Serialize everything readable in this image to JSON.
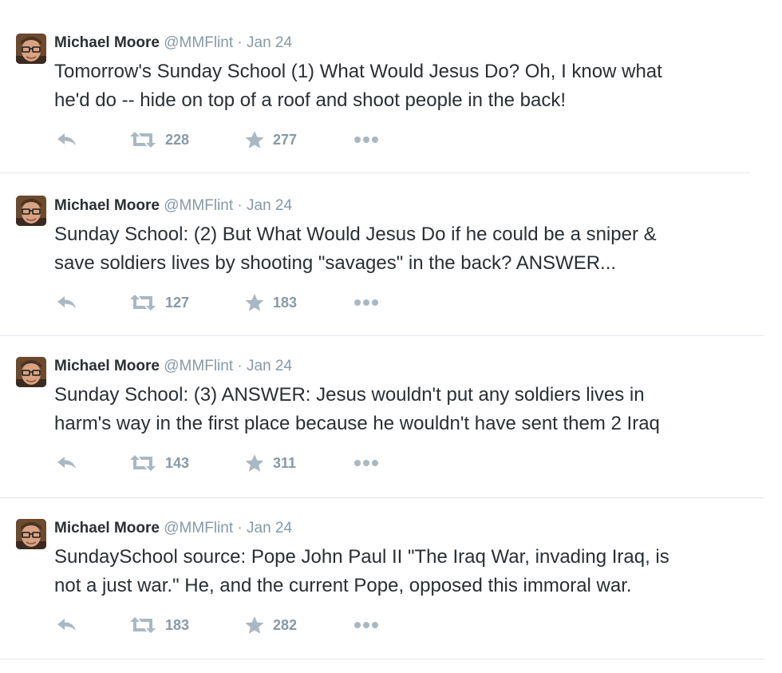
{
  "tweets": [
    {
      "fullname": "Michael Moore",
      "handle": "@MMFlint",
      "separator": "·",
      "time": "Jan 24",
      "text": "Tomorrow's Sunday School (1) What Would Jesus Do? Oh, I know what\nhe'd do -- hide on top of a roof and shoot people in the back!",
      "retweets": "228",
      "favorites": "277"
    },
    {
      "fullname": "Michael Moore",
      "handle": "@MMFlint",
      "separator": "·",
      "time": "Jan 24",
      "text": "Sunday School: (2) But What Would Jesus Do if he could be a sniper &\nsave soldiers lives by shooting \"savages\" in the back? ANSWER...",
      "retweets": "127",
      "favorites": "183"
    },
    {
      "fullname": "Michael Moore",
      "handle": "@MMFlint",
      "separator": "·",
      "time": "Jan 24",
      "text": "Sunday School: (3) ANSWER: Jesus wouldn't put any soldiers lives in\nharm's way in the first place because he wouldn't have sent them 2 Iraq",
      "retweets": "143",
      "favorites": "311"
    },
    {
      "fullname": "Michael Moore",
      "handle": "@MMFlint",
      "separator": "·",
      "time": "Jan 24",
      "text": "SundaySchool source: Pope John Paul II \"The Iraq War, invading Iraq, is\nnot a just war.\" He, and the current Pope, opposed this immoral war.",
      "retweets": "183",
      "favorites": "282"
    }
  ],
  "icons": {
    "reply": "reply-icon",
    "retweet": "retweet-icon",
    "favorite": "star-icon",
    "more": "more-dots-icon"
  },
  "colors": {
    "text": "#292f33",
    "muted": "#8899a6",
    "icon": "#aab8c2",
    "divider": "#e1e8ed",
    "background": "#ffffff"
  }
}
